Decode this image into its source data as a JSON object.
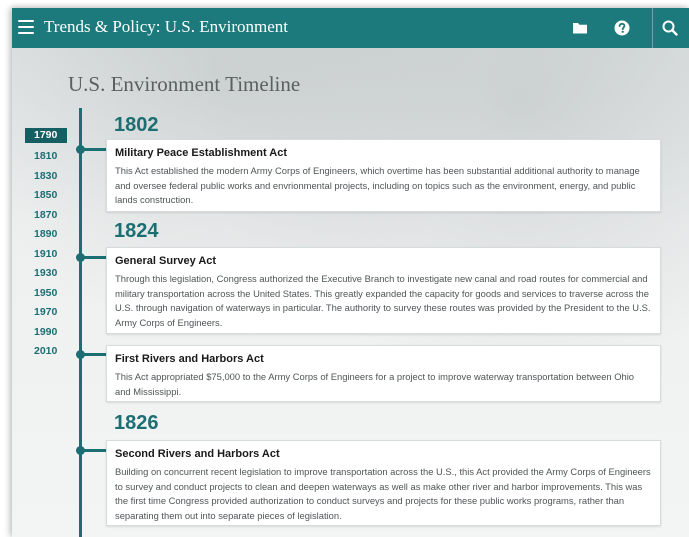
{
  "header": {
    "title": "Trends & Policy: U.S. Environment",
    "icons": [
      "menu-icon",
      "folder-icon",
      "help-icon",
      "search-icon"
    ]
  },
  "page": {
    "title": "U.S. Environment Timeline"
  },
  "decades": [
    "1790",
    "1810",
    "1830",
    "1850",
    "1870",
    "1890",
    "1910",
    "1930",
    "1950",
    "1970",
    "1990",
    "2010"
  ],
  "active_decade": "1790",
  "timeline": {
    "years": [
      "1802",
      "1824",
      "1826"
    ],
    "entries": [
      {
        "title": "Military Peace Establishment Act",
        "body": "This Act established the modern Army Corps of Engineers, which overtime has been substantial additional authority to manage and oversee federal public works and envrionmental projects, including on topics such as the environment, energy, and public lands construction."
      },
      {
        "title": "General Survey Act",
        "body": "Through this legislation, Congress authorized the Executive Branch to investigate new canal and road routes for commercial and military transportation across the United States. This greatly expanded the capacity for goods and services to traverse across the U.S. through navigation of waterways in particular. The authority to survey these routes was provided by the President to the U.S. Army Corps of Engineers."
      },
      {
        "title": "First Rivers and Harbors Act",
        "body": "This Act appropriated $75,000 to the Army Corps of Engineers for a project to improve waterway transportation between Ohio and Mississippi."
      },
      {
        "title": "Second Rivers and Harbors Act",
        "body": "Building on concurrent recent legislation to improve transportation across the U.S., this Act provided the Army Corps of Engineers to survey and conduct projects to clean and deepen waterways as well as make other river and harbor improvements. This was the first time Congress provided authorization to conduct surveys and projects for these public works programs, rather than separating them out into separate pieces of legislation."
      }
    ]
  },
  "colors": {
    "header_bg": "#1c7a7c",
    "accent": "#1b6f72",
    "active_decade_bg": "#155f63"
  }
}
